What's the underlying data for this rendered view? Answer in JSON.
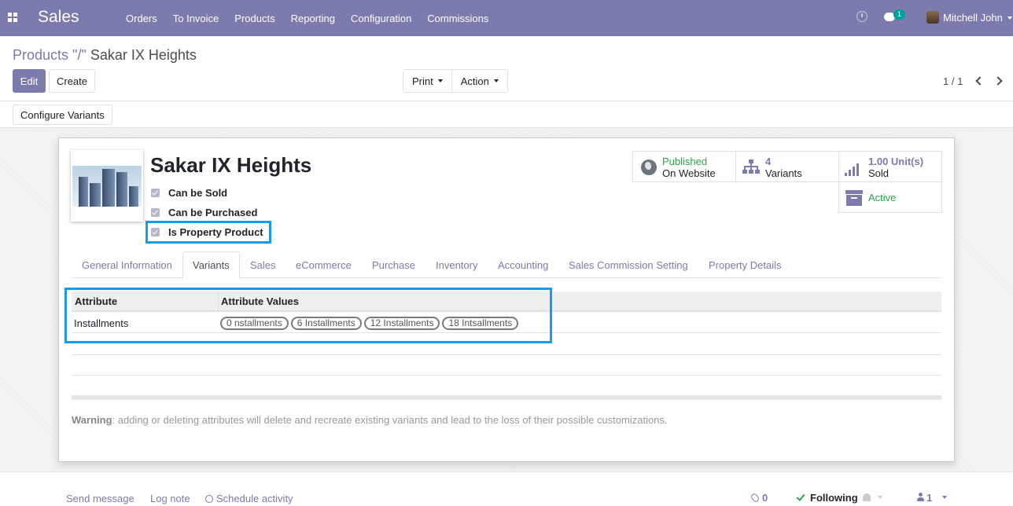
{
  "navbar": {
    "app_name": "Sales",
    "menu": [
      "Orders",
      "To Invoice",
      "Products",
      "Reporting",
      "Configuration",
      "Commissions"
    ],
    "chat_count": "1",
    "user_name": "Mitchell John"
  },
  "control_panel": {
    "breadcrumb_parent": "Products",
    "breadcrumb_sep": " \"/\" ",
    "breadcrumb_current": "Sakar IX Heights",
    "edit_label": "Edit",
    "create_label": "Create",
    "print_label": "Print",
    "action_label": "Action",
    "pager": "1 / 1"
  },
  "statusbar": {
    "configure_variants_label": "Configure Variants"
  },
  "product": {
    "name": "Sakar IX Heights",
    "checkboxes": [
      {
        "label": "Can be Sold",
        "checked": true
      },
      {
        "label": "Can be Purchased",
        "checked": true
      },
      {
        "label": "Is Property Product",
        "checked": true
      }
    ]
  },
  "smart_buttons": {
    "website_status": "Published",
    "website_sub": "On Website",
    "variants_count": "4",
    "variants_label": "Variants",
    "sold_value": "1.00 Unit(s)",
    "sold_label": "Sold",
    "active_label": "Active"
  },
  "tabs": [
    "General Information",
    "Variants",
    "Sales",
    "eCommerce",
    "Purchase",
    "Inventory",
    "Accounting",
    "Sales Commission Setting",
    "Property Details"
  ],
  "active_tab": "Variants",
  "variants_table": {
    "headers": [
      "Attribute",
      "Attribute Values"
    ],
    "rows": [
      {
        "attribute": "Installments",
        "values": [
          "0 nstallments",
          "6 Installments",
          "12 Installments",
          "18 Intsallments"
        ]
      }
    ]
  },
  "warning": {
    "prefix": "Warning",
    "text": ": adding or deleting attributes will delete and recreate existing variants and lead to the loss of their possible customizations."
  },
  "chatter": {
    "send_message": "Send message",
    "log_note": "Log note",
    "schedule_activity": "Schedule activity",
    "attachments": "0",
    "following": "Following",
    "followers": "1"
  },
  "colors": {
    "brand": "#7c7bad",
    "published": "#28a745",
    "highlight": "#1a9ae8"
  }
}
